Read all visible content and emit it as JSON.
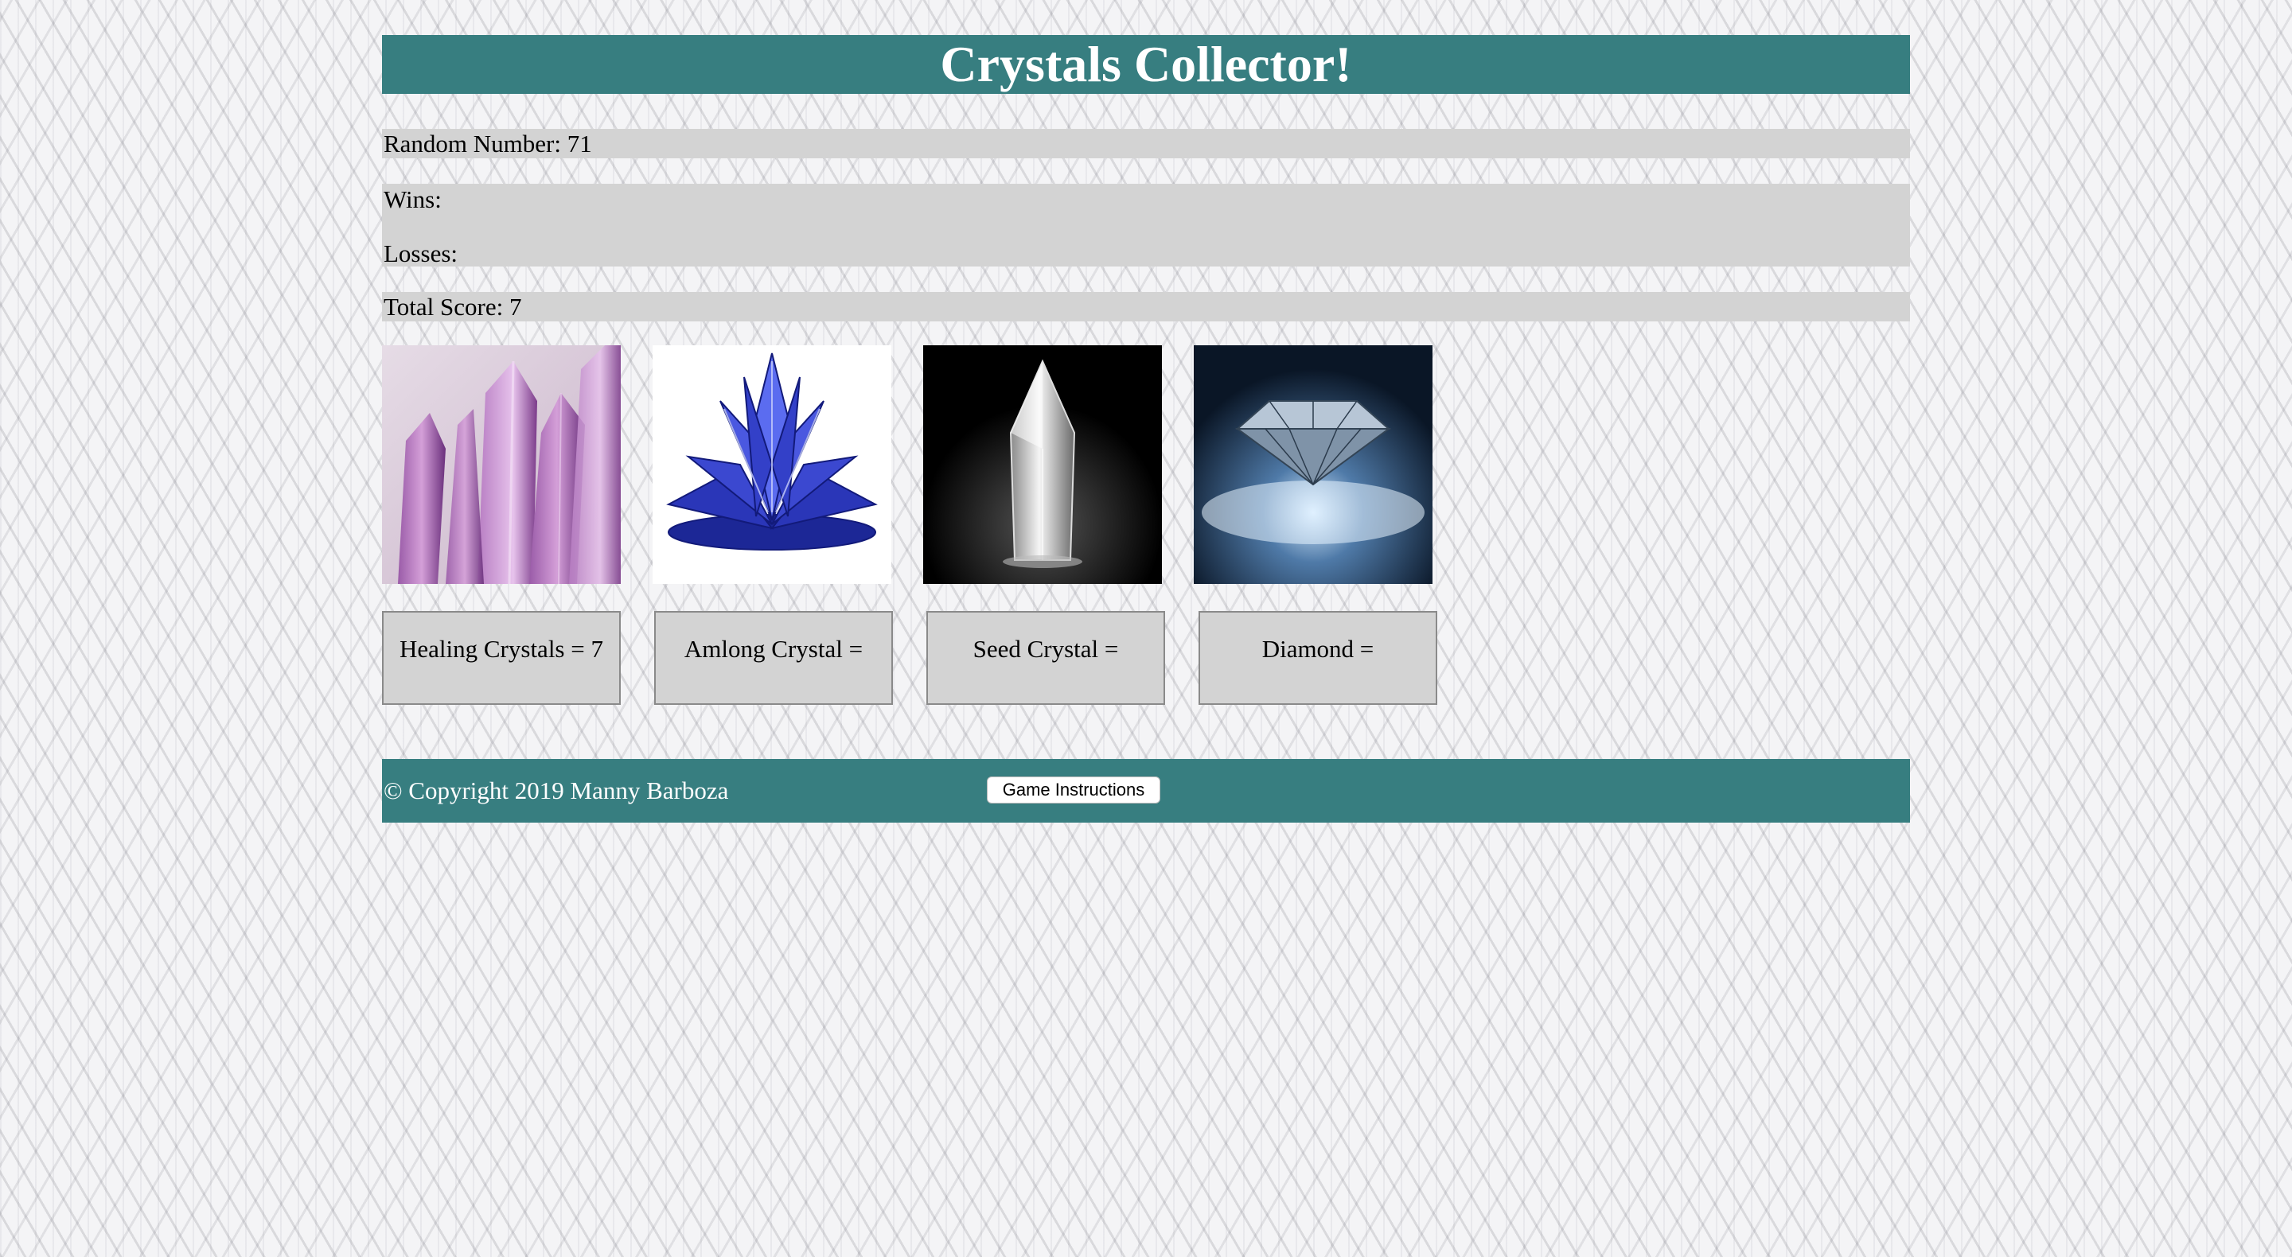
{
  "header": {
    "title": "Crystals Collector!"
  },
  "stats": {
    "random_number": "Random Number: 71",
    "wins": "Wins:",
    "losses": "Losses:",
    "total_score": "Total Score: 7"
  },
  "crystals": [
    {
      "image_icon": "amethyst-crystal-icon",
      "button_label": "Healing Crystals = 7"
    },
    {
      "image_icon": "blue-lotus-crystal-icon",
      "button_label": "Amlong Crystal ="
    },
    {
      "image_icon": "clear-quartz-crystal-icon",
      "button_label": "Seed Crystal ="
    },
    {
      "image_icon": "diamond-icon",
      "button_label": "Diamond ="
    }
  ],
  "footer": {
    "copyright": "© Copyright 2019 Manny Barboza",
    "instructions_button": "Game Instructions"
  },
  "colors": {
    "header_bg": "#377e80",
    "stat_bg": "#d3d3d3",
    "button_bg": "#d3d3d3"
  }
}
